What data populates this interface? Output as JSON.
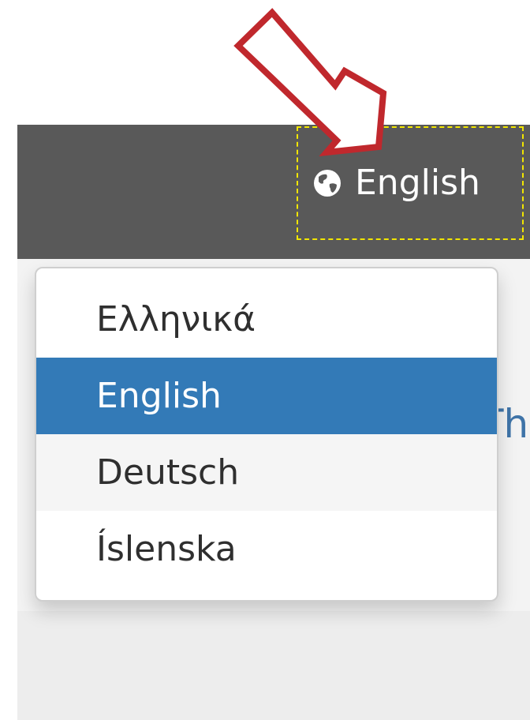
{
  "header": {
    "language_label": "English"
  },
  "language_menu": {
    "items": [
      {
        "label": "Ελληνικά",
        "state": "normal"
      },
      {
        "label": "English",
        "state": "selected"
      },
      {
        "label": "Deutsch",
        "state": "hover"
      },
      {
        "label": "Íslenska",
        "state": "normal"
      }
    ]
  },
  "page": {
    "partial_heading": "Th"
  },
  "colors": {
    "header_bg": "#595959",
    "selected_bg": "#337ab7",
    "hover_bg": "#f5f5f5",
    "highlight_border": "#f2e600",
    "annotation_arrow": "#c0282d"
  },
  "icons": {
    "language": "globe-icon"
  }
}
